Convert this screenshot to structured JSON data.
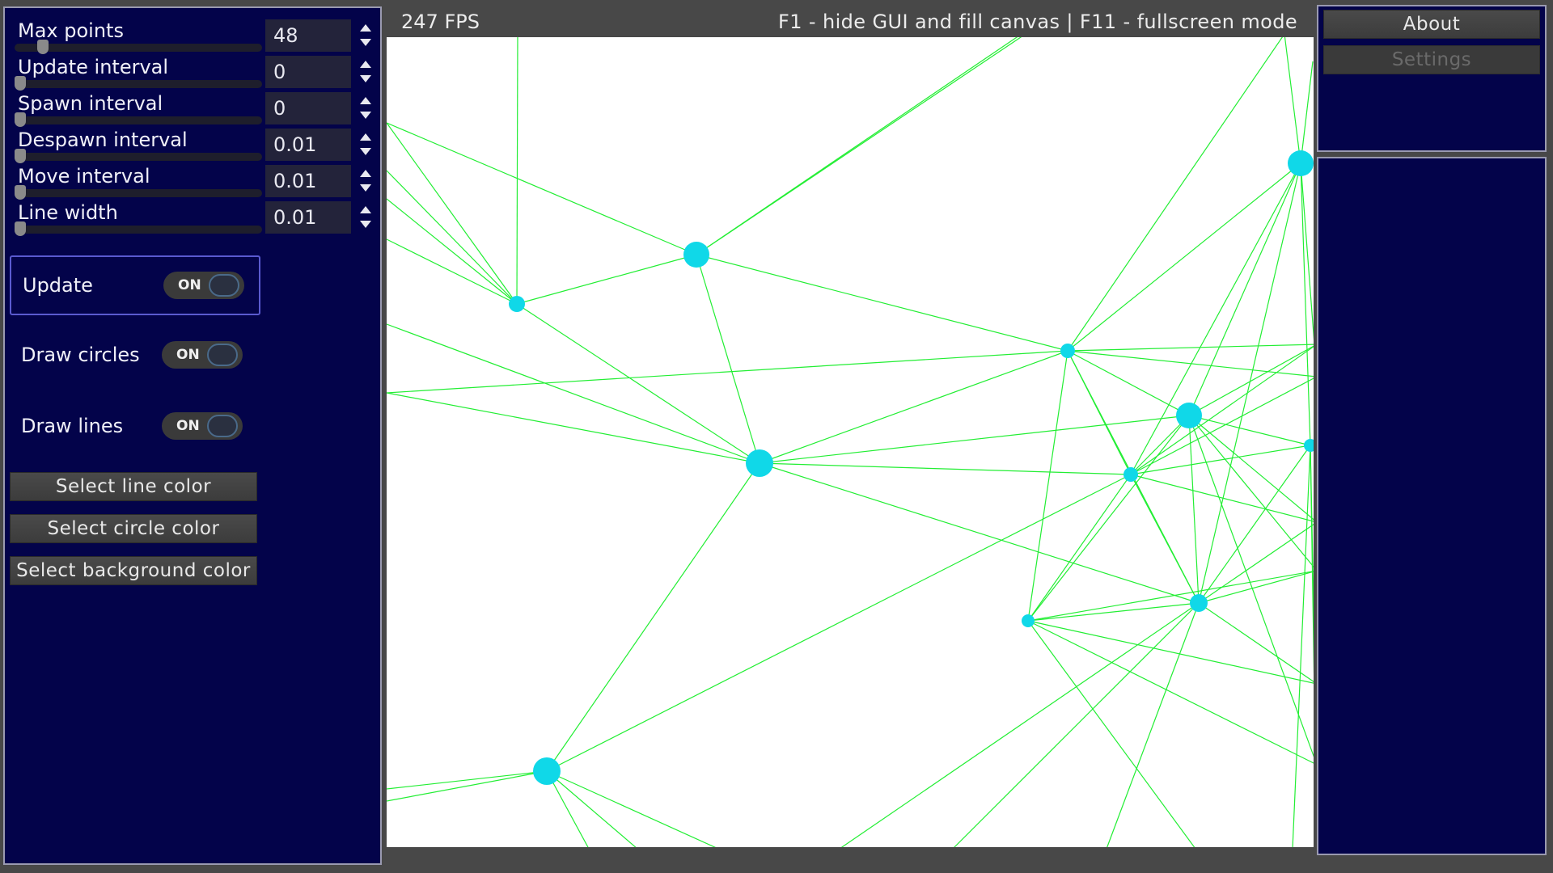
{
  "topbar": {
    "fps": "247 FPS",
    "hint": "F1 - hide GUI and fill canvas |  F11 - fullscreen mode"
  },
  "left_panel": {
    "sliders": [
      {
        "label": "Max points",
        "value": "48",
        "level": 0.09
      },
      {
        "label": "Update interval",
        "value": "0",
        "level": 0.0
      },
      {
        "label": "Spawn interval",
        "value": "0",
        "level": 0.0
      },
      {
        "label": "Despawn interval",
        "value": "0.01",
        "level": 0.0
      },
      {
        "label": "Move interval",
        "value": "0.01",
        "level": 0.0
      },
      {
        "label": "Line width",
        "value": "0.01",
        "level": 0.0
      }
    ],
    "toggles": [
      {
        "label": "Update",
        "state": "ON"
      },
      {
        "label": "Draw circles",
        "state": "ON"
      },
      {
        "label": "Draw lines",
        "state": "ON"
      }
    ],
    "buttons": {
      "line_color": "Select line color",
      "circle_color": "Select circle color",
      "background_color": "Select background color"
    }
  },
  "right_panel": {
    "about": "About",
    "settings": "Settings"
  },
  "colors": {
    "panel_bg": "#03034a",
    "canvas_bg": "#ffffff",
    "line_color": "#22ee33",
    "circle_color": "#10d8e8"
  }
}
